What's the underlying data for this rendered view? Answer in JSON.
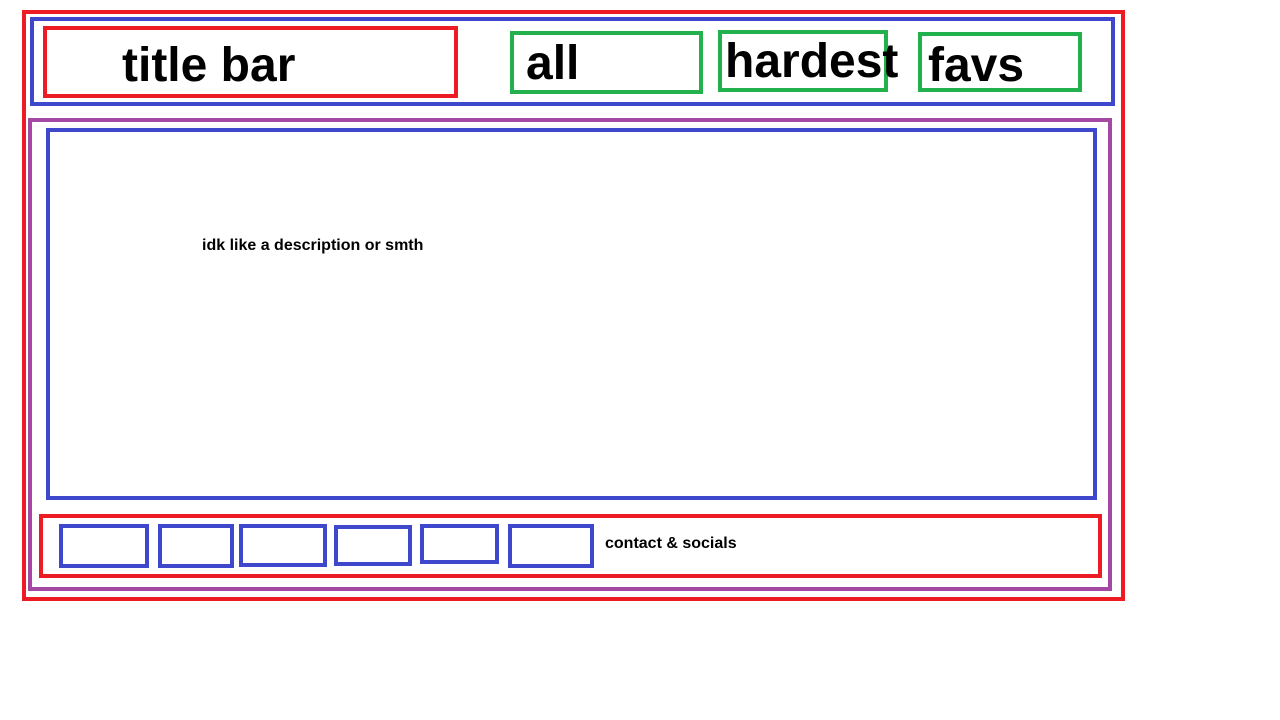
{
  "header": {
    "title": "title bar",
    "nav": [
      {
        "label": "all"
      },
      {
        "label": "hardest"
      },
      {
        "label": "favs"
      }
    ]
  },
  "main": {
    "description": "idk like a description or smth"
  },
  "footer": {
    "contact_label": "contact & socials",
    "social_slots": [
      {},
      {},
      {},
      {},
      {},
      {}
    ]
  },
  "colors": {
    "red": "#ed1c24",
    "blue": "#3f48cc",
    "green": "#22b14c",
    "purple": "#a349a4"
  }
}
